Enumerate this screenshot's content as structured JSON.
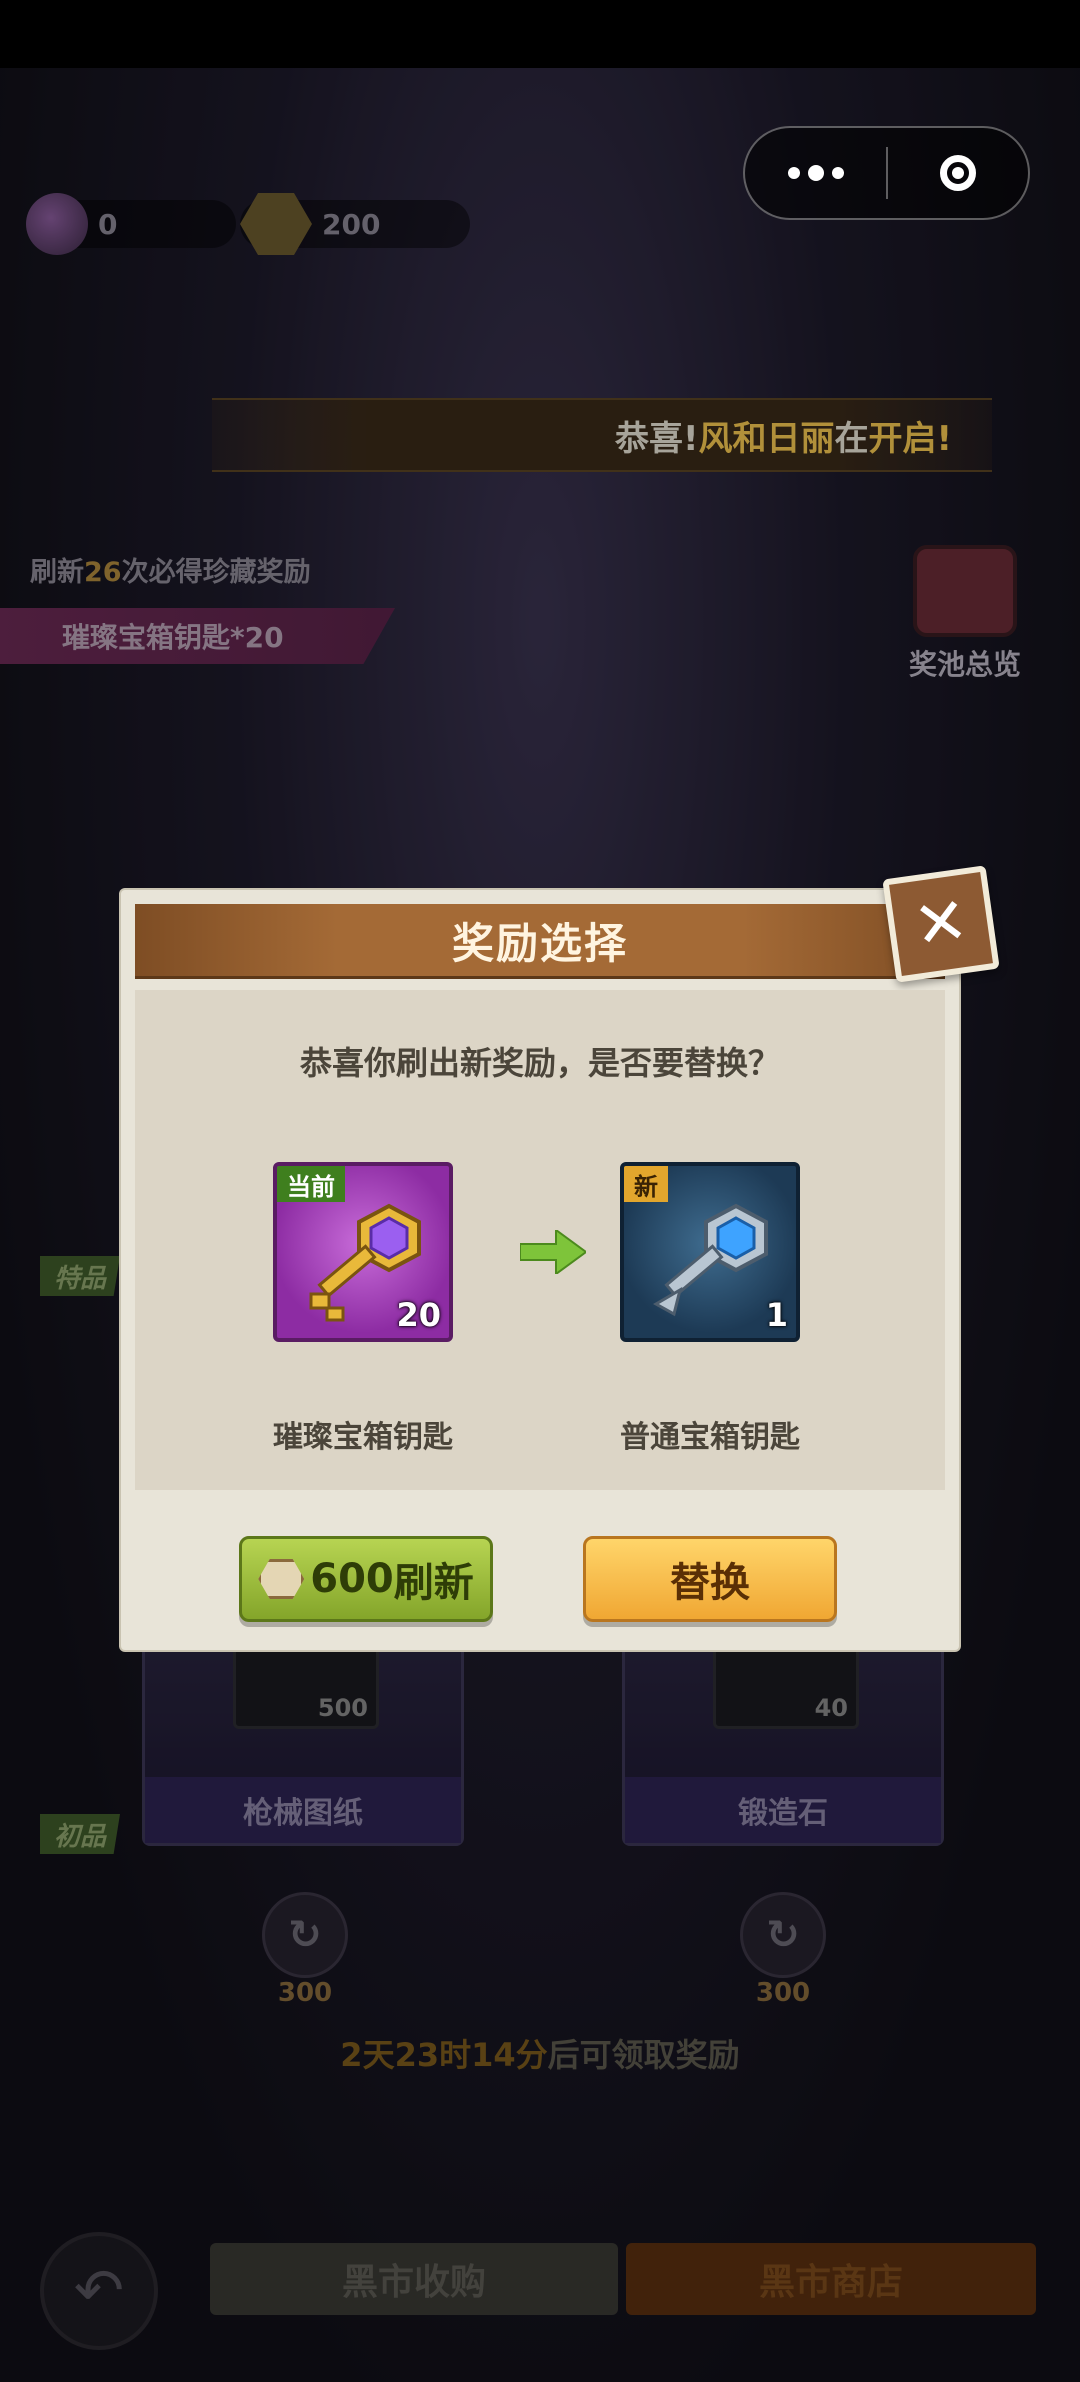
{
  "currencies": {
    "coins": "0",
    "gems": "200"
  },
  "banner": {
    "prefix": "恭喜!",
    "name": "风和日丽",
    "middle": "在",
    "suffix": "开启!"
  },
  "refresh_tip": {
    "before": "刷新",
    "count": "26",
    "after": "次必得珍藏奖励"
  },
  "pink_ribbon": "璀璨宝箱钥匙*20",
  "pool_overview": "奖池总览",
  "tiers": {
    "special": "特品",
    "basic": "初品"
  },
  "slots": [
    {
      "label": "枪械图纸",
      "qty": "500",
      "cost": "300"
    },
    {
      "label": "锻造石",
      "qty": "40",
      "cost": "300"
    }
  ],
  "timer": {
    "days": "2",
    "days_unit": "天",
    "hours": "23",
    "hours_unit": "时",
    "minutes": "14",
    "minutes_unit": "分",
    "suffix": "后可领取奖励"
  },
  "bottom_nav": {
    "buy": "黑市收购",
    "shop": "黑市商店"
  },
  "dialog": {
    "title": "奖励选择",
    "question": "恭喜你刷出新奖励，是否要替换？",
    "current": {
      "tag": "当前",
      "qty": "20",
      "name": "璀璨宝箱钥匙"
    },
    "new": {
      "tag": "新",
      "qty": "1",
      "name": "普通宝箱钥匙"
    },
    "refresh_button": {
      "cost": "600",
      "label": "刷新"
    },
    "replace_button": "替换"
  },
  "icons": {
    "close": "close-icon",
    "arrow": "arrow-right-icon",
    "gem": "gem-icon",
    "back": "back-icon",
    "refresh": "refresh-icon"
  },
  "colors": {
    "dialog_bg": "#e8e4d8",
    "header": "#a46a36",
    "refresh_btn": "#9fbf3a",
    "replace_btn": "#f6bb45"
  }
}
